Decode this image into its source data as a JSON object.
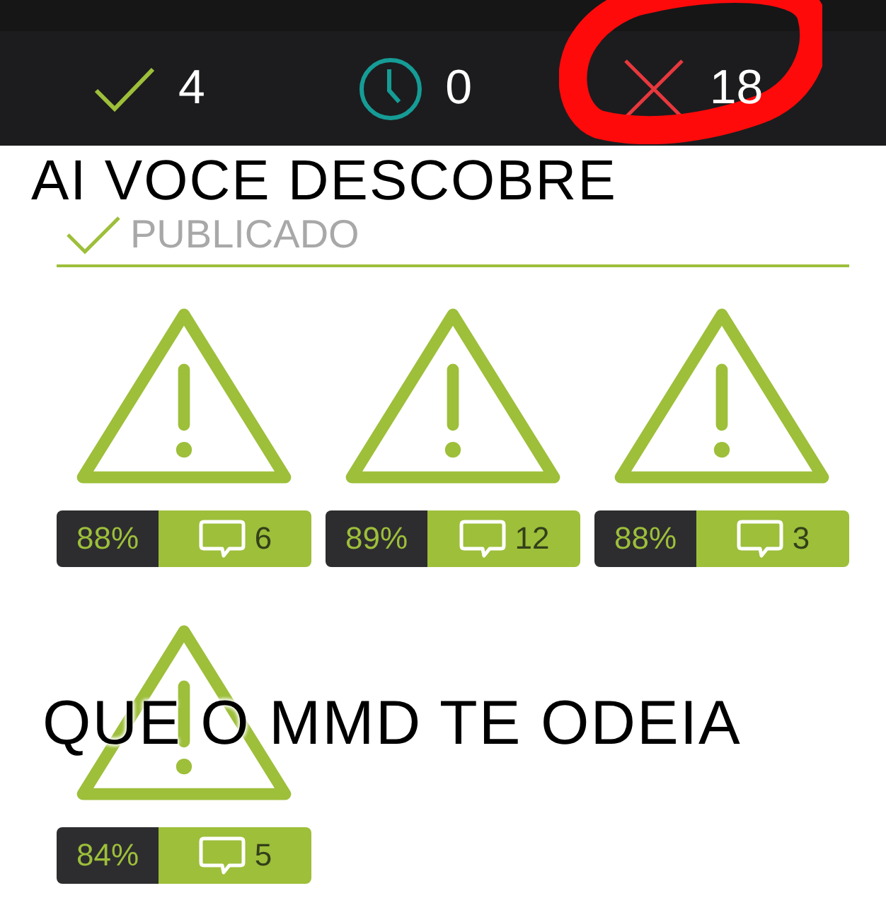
{
  "status_counts": [
    {
      "kind": "correct",
      "count": "4",
      "circled": false
    },
    {
      "kind": "pending",
      "count": "0",
      "circled": false
    },
    {
      "kind": "wrong",
      "count": "18",
      "circled": true
    }
  ],
  "section": {
    "title": "PUBLICADO"
  },
  "posts": [
    {
      "score": "88%",
      "comments": "6"
    },
    {
      "score": "89%",
      "comments": "12"
    },
    {
      "score": "88%",
      "comments": "3"
    },
    {
      "score": "84%",
      "comments": "5"
    }
  ],
  "captions": {
    "top": "AI VOCE DESCOBRE",
    "bottom": "QUE O MMD TE ODEIA"
  }
}
